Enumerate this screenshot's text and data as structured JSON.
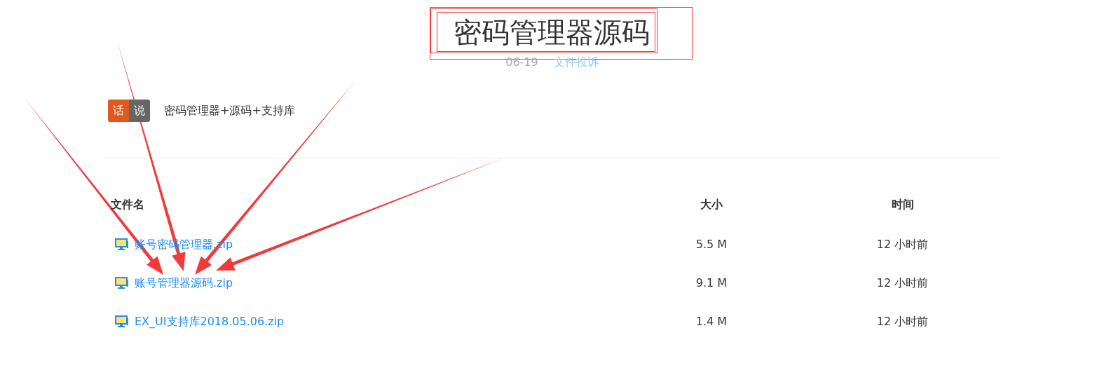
{
  "title": "密码管理器源码",
  "meta": {
    "date": "06-19",
    "report_link": "文件投诉"
  },
  "badge": [
    "话",
    "说"
  ],
  "description": "密码管理器+源码+支持库",
  "table": {
    "columns": [
      "文件名",
      "大小",
      "时间"
    ],
    "rows": [
      {
        "name": "账号密码管理器.zip",
        "size": "5.5 M",
        "time": "12 小时前"
      },
      {
        "name": "账号管理器源码.zip",
        "size": "9.1 M",
        "time": "12 小时前"
      },
      {
        "name": "EX_UI支持库2018.05.06.zip",
        "size": "1.4 M",
        "time": "12 小时前"
      }
    ]
  }
}
